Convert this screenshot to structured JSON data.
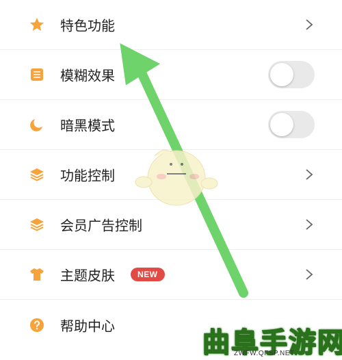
{
  "settings": {
    "items": [
      {
        "label": "特色功能",
        "icon": "star-icon",
        "control": "chevron"
      },
      {
        "label": "模糊效果",
        "icon": "blur-icon",
        "control": "toggle",
        "enabled": false
      },
      {
        "label": "暗黑模式",
        "icon": "moon-icon",
        "control": "toggle",
        "enabled": false
      },
      {
        "label": "功能控制",
        "icon": "layers-icon",
        "control": "chevron"
      },
      {
        "label": "会员广告控制",
        "icon": "layers-icon",
        "control": "chevron"
      },
      {
        "label": "主题皮肤",
        "icon": "shirt-icon",
        "control": "chevron",
        "badge": "NEW"
      },
      {
        "label": "帮助中心",
        "icon": "help-icon",
        "control": "none"
      }
    ]
  },
  "watermark": {
    "title": "曲阜手游网",
    "url": "ZWFW.QFSP.NET"
  },
  "colors": {
    "icon": "#f5a33a",
    "badge": "#e24a46",
    "arrow": "#6dd36a",
    "toggle_off": "#e9e9e9"
  }
}
